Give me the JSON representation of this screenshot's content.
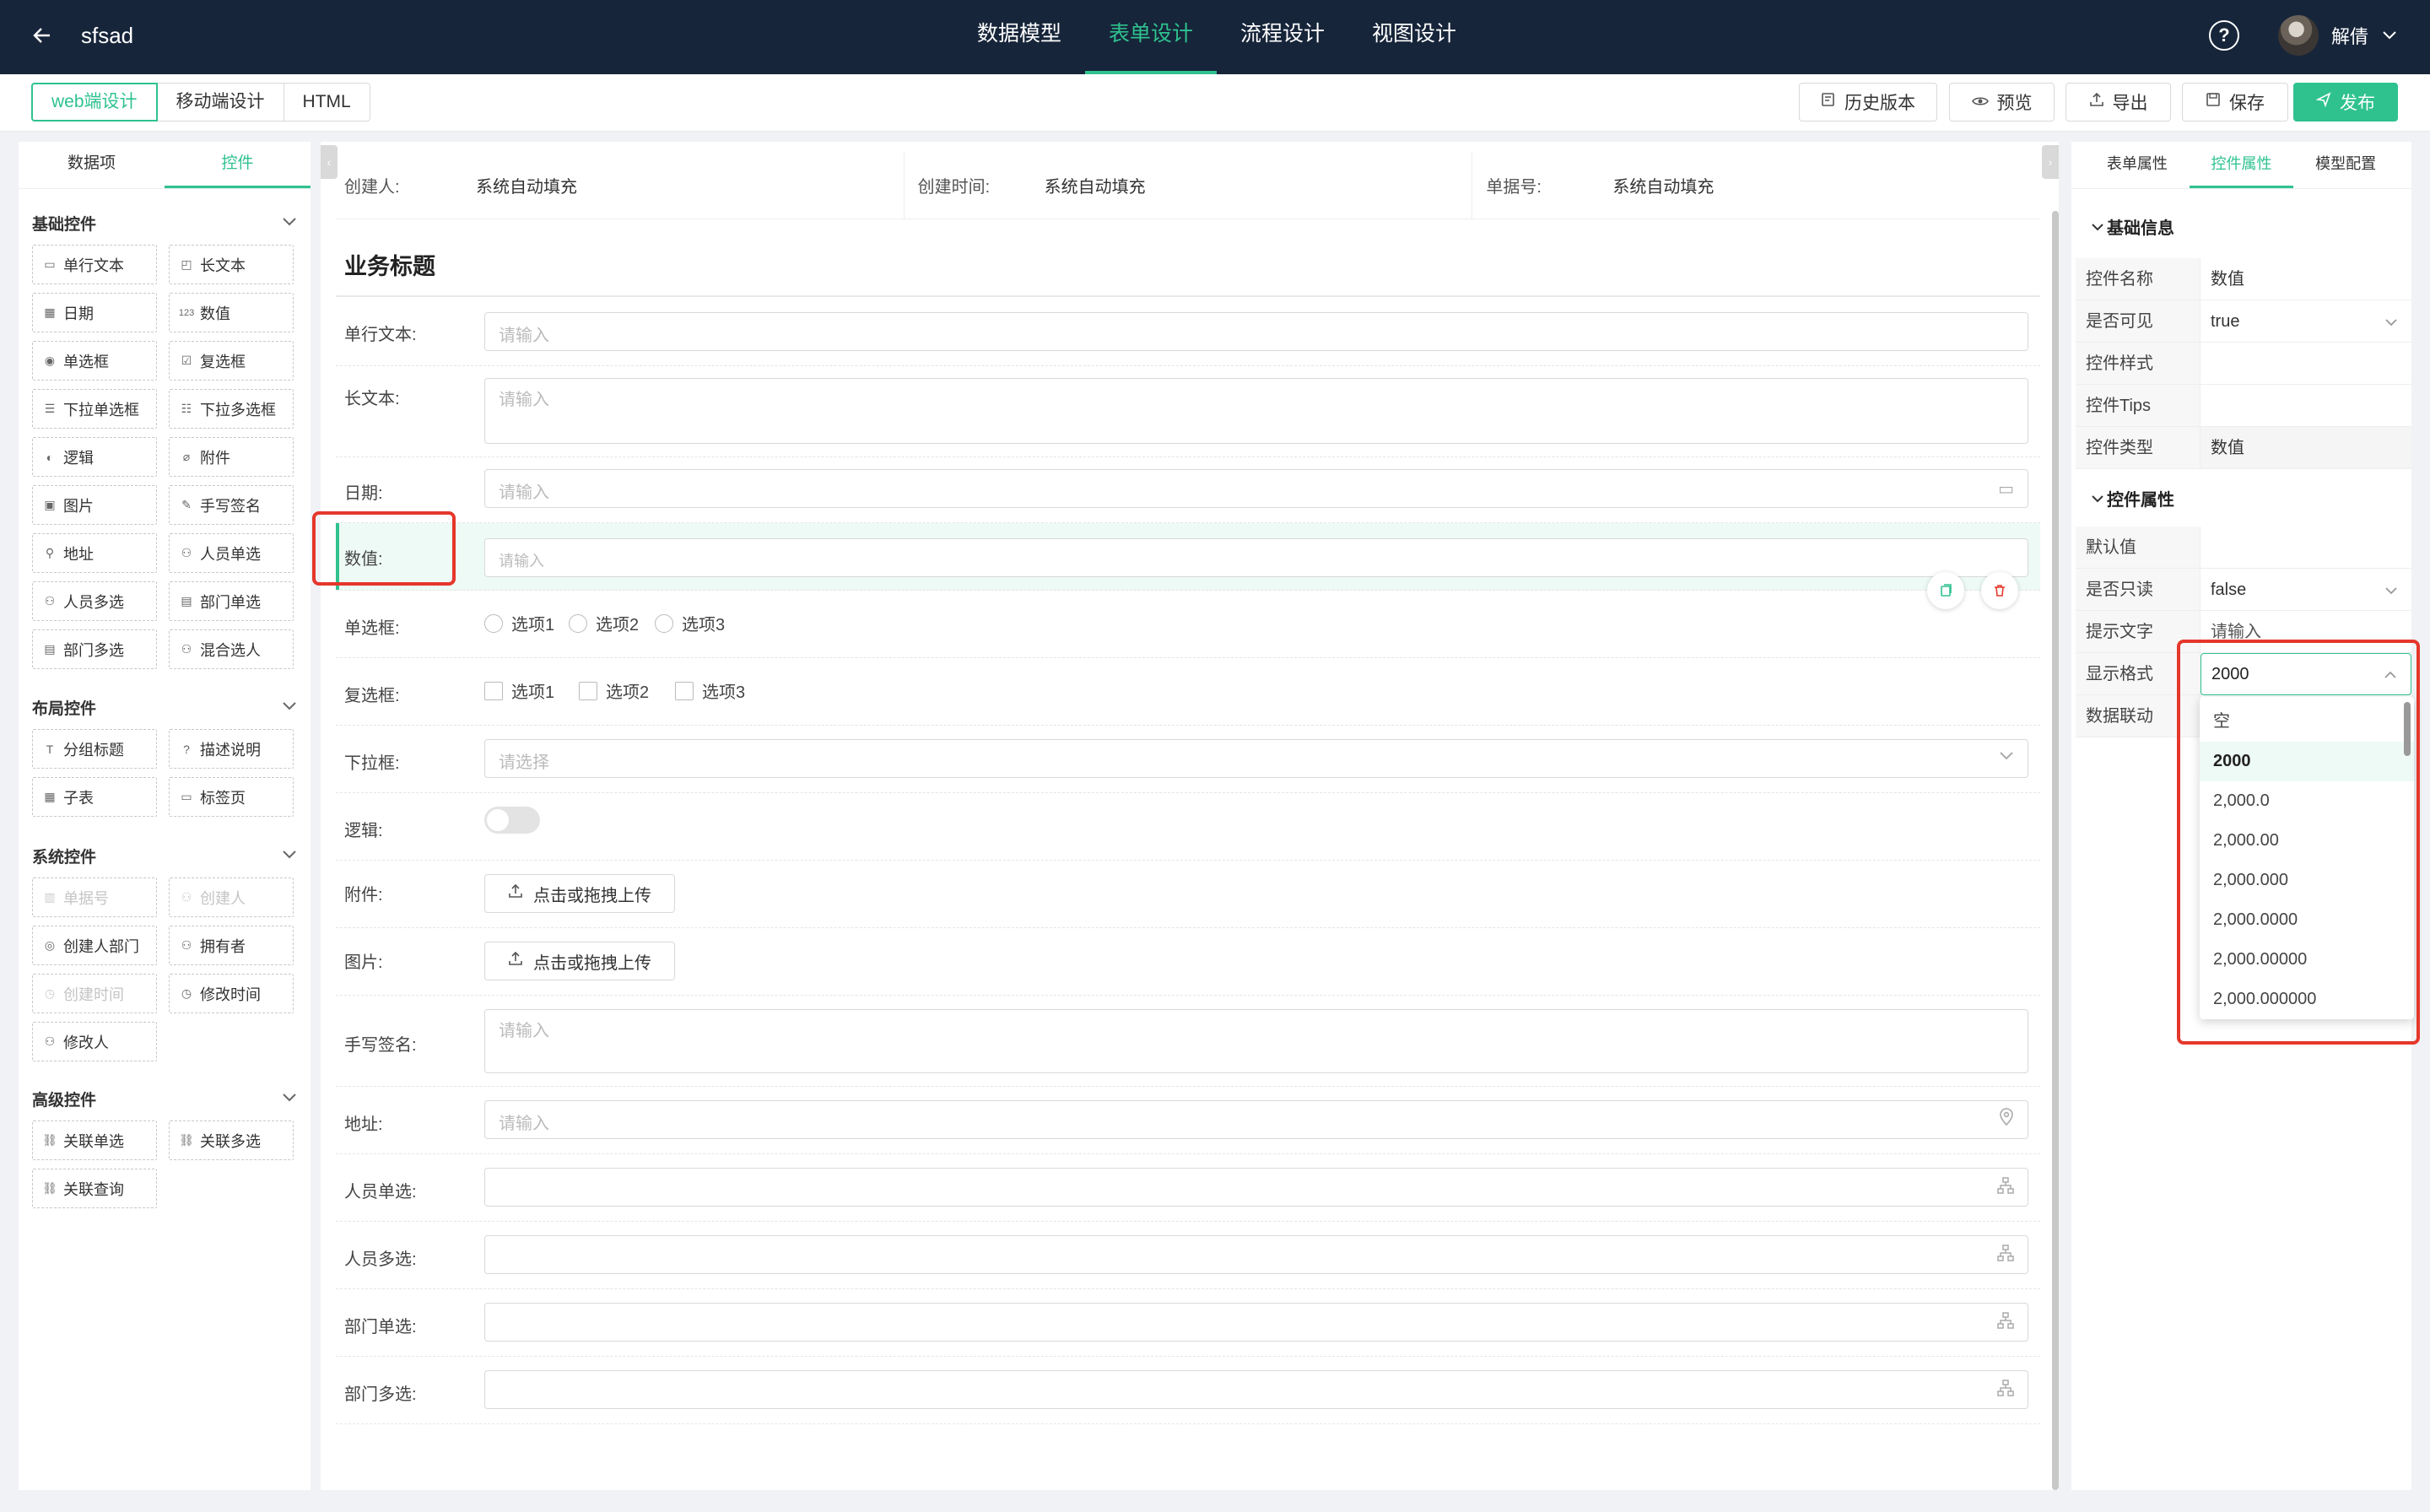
{
  "topbar": {
    "title": "sfsad",
    "tabs": [
      {
        "label": "数据模型",
        "active": false
      },
      {
        "label": "表单设计",
        "active": true
      },
      {
        "label": "流程设计",
        "active": false
      },
      {
        "label": "视图设计",
        "active": false
      }
    ],
    "user_name": "解倩"
  },
  "toolbar": {
    "mode_tabs": [
      "web端设计",
      "移动端设计",
      "HTML"
    ],
    "history_label": "历史版本",
    "preview_label": "预览",
    "export_label": "导出",
    "save_label": "保存",
    "publish_label": "发布"
  },
  "left_panel": {
    "tabs": [
      "数据项",
      "控件"
    ],
    "basic": {
      "title": "基础控件",
      "items": [
        "单行文本",
        "长文本",
        "日期",
        "数值",
        "单选框",
        "复选框",
        "下拉单选框",
        "下拉多选框",
        "逻辑",
        "附件",
        "图片",
        "手写签名",
        "地址",
        "人员单选",
        "人员多选",
        "部门单选",
        "部门多选",
        "混合选人"
      ]
    },
    "layout": {
      "title": "布局控件",
      "items": [
        "分组标题",
        "描述说明",
        "子表",
        "标签页"
      ]
    },
    "system": {
      "title": "系统控件",
      "items": [
        "单据号",
        "创建人",
        "创建人部门",
        "拥有者",
        "创建时间",
        "修改时间",
        "修改人"
      ]
    },
    "advanced": {
      "title": "高级控件",
      "items": [
        "关联单选",
        "关联多选",
        "关联查询"
      ]
    }
  },
  "canvas": {
    "info": [
      {
        "label": "创建人:",
        "value": "系统自动填充"
      },
      {
        "label": "创建时间:",
        "value": "系统自动填充"
      },
      {
        "label": "单据号:",
        "value": "系统自动填充"
      }
    ],
    "section_title": "业务标题",
    "placeholder_input": "请输入",
    "placeholder_select": "请选择",
    "upload_label": "点击或拖拽上传",
    "fields": {
      "single_text": "单行文本:",
      "long_text": "长文本:",
      "date": "日期:",
      "number": "数值:",
      "radio": "单选框:",
      "checkbox": "复选框:",
      "dropdown": "下拉框:",
      "logic": "逻辑:",
      "attachment": "附件:",
      "image": "图片:",
      "signature": "手写签名:",
      "address": "地址:",
      "person_single": "人员单选:",
      "person_multi": "人员多选:",
      "dept_single": "部门单选:",
      "dept_multi": "部门多选:"
    },
    "options": [
      "选项1",
      "选项2",
      "选项3"
    ]
  },
  "right_panel": {
    "tabs": [
      "表单属性",
      "控件属性",
      "模型配置"
    ],
    "basic_group": "基础信息",
    "basic_props": [
      {
        "key": "控件名称",
        "value": "数值"
      },
      {
        "key": "是否可见",
        "value": "true"
      },
      {
        "key": "控件样式",
        "value": ""
      },
      {
        "key": "控件Tips",
        "value": ""
      },
      {
        "key": "控件类型",
        "value": "数值"
      }
    ],
    "ctrl_group": "控件属性",
    "ctrl_props": [
      {
        "key": "默认值",
        "value": ""
      },
      {
        "key": "是否只读",
        "value": "false"
      },
      {
        "key": "提示文字",
        "value": "请输入"
      },
      {
        "key": "显示格式",
        "value": "2000"
      },
      {
        "key": "数据联动",
        "value": ""
      }
    ],
    "format_options": [
      "空",
      "2000",
      "2,000.0",
      "2,000.00",
      "2,000.000",
      "2,000.0000",
      "2,000.00000",
      "2,000.000000"
    ],
    "format_selected": "2000"
  },
  "colors": {
    "accent": "#2fc28f",
    "topbar": "#17253a",
    "highlight": "#e5372b"
  }
}
